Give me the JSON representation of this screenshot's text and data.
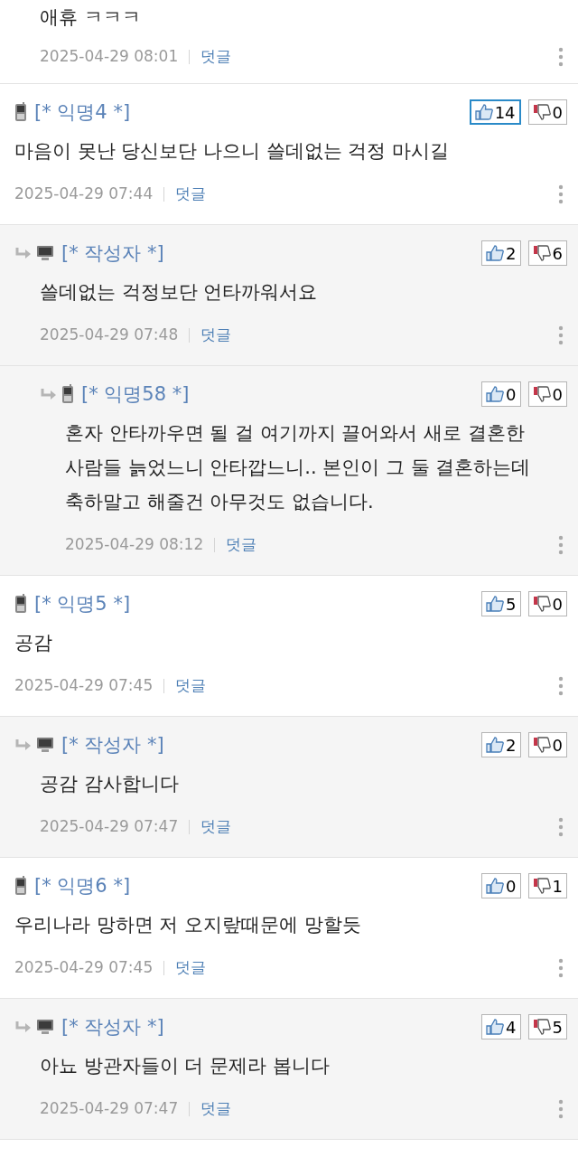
{
  "top_comment": {
    "text": "애휴 ㅋㅋㅋ",
    "date": "2025-04-29 08:01",
    "reply_link": "덧글"
  },
  "comments": [
    {
      "kind": "mobile",
      "author": "[* 익명4 *]",
      "likes": "14",
      "liked": true,
      "dislikes": "0",
      "text": "마음이 못난 당신보단 나으니 쓸데없는 걱정 마시길",
      "date": "2025-04-29 07:44",
      "reply_link": "덧글",
      "children": [
        {
          "kind": "pc",
          "author": "[* 작성자 *]",
          "likes": "2",
          "liked": false,
          "dislikes": "6",
          "text": "쓸데없는 걱정보단 언타까워서요",
          "date": "2025-04-29 07:48",
          "reply_link": "덧글",
          "children": [
            {
              "kind": "mobile",
              "author": "[* 익명58 *]",
              "likes": "0",
              "liked": false,
              "dislikes": "0",
              "text": "혼자 안타까우면 될 걸 여기까지 끌어와서 새로 결혼한 사람들 늙었느니 안타깝느니.. 본인이 그 둘 결혼하는데 축하말고 해줄건 아무것도 없습니다.",
              "date": "2025-04-29 08:12",
              "reply_link": "덧글"
            }
          ]
        }
      ]
    },
    {
      "kind": "mobile",
      "author": "[* 익명5 *]",
      "likes": "5",
      "liked": false,
      "dislikes": "0",
      "text": "공감",
      "date": "2025-04-29 07:45",
      "reply_link": "덧글",
      "children": [
        {
          "kind": "pc",
          "author": "[* 작성자 *]",
          "likes": "2",
          "liked": false,
          "dislikes": "0",
          "text": "공감 감사합니다",
          "date": "2025-04-29 07:47",
          "reply_link": "덧글"
        }
      ]
    },
    {
      "kind": "mobile",
      "author": "[* 익명6 *]",
      "likes": "0",
      "liked": false,
      "dislikes": "1",
      "text": "우리나라 망하면 저 오지랖때문에 망할듯",
      "date": "2025-04-29 07:45",
      "reply_link": "덧글",
      "children": [
        {
          "kind": "pc",
          "author": "[* 작성자 *]",
          "likes": "4",
          "liked": false,
          "dislikes": "5",
          "text": "아뇨 방관자들이 더 문제라 봅니다",
          "date": "2025-04-29 07:47",
          "reply_link": "덧글"
        }
      ]
    }
  ]
}
